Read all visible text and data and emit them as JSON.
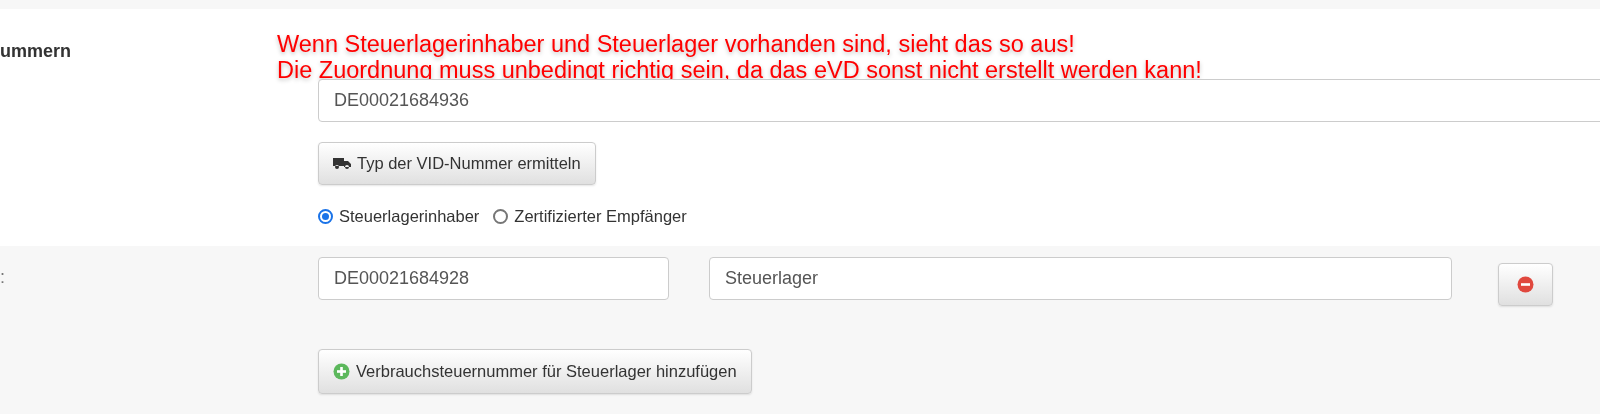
{
  "section_label": "ummern",
  "notice": [
    "Wenn Steuerlagerinhaber und Steuerlager vorhanden sind, sieht das so aus!",
    "Die Zuordnung muss unbedingt richtig sein, da das eVD sonst nicht erstellt werden kann!"
  ],
  "vid_field": {
    "value": "DE00021684936"
  },
  "determine_button": {
    "label": "Typ der VID-Nummer ermitteln"
  },
  "type_options": [
    {
      "label": "Steuerlagerinhaber",
      "selected": true
    },
    {
      "label": "Zertifizierter Empfänger",
      "selected": false
    }
  ],
  "warehouse_section": {
    "label": ":",
    "rows": [
      {
        "number": "DE00021684928",
        "name": "Steuerlager"
      }
    ],
    "add_button": {
      "label": "Verbrauchsteuernummer für Steuerlager hinzufügen"
    }
  }
}
